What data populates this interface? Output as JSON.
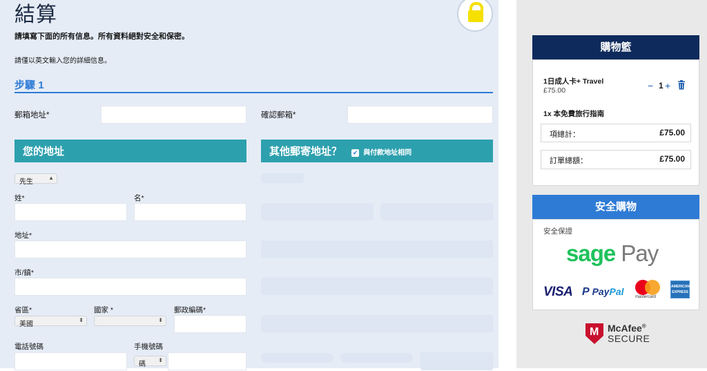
{
  "page": {
    "title": "結算",
    "intro": "請填寫下面的所有信息。所有資料絕對安全和保密。",
    "english_note": "請僅以英文輸入您的詳細信息。",
    "step_label": "步驟",
    "step_number": "1"
  },
  "email": {
    "email_label": "郵箱地址*",
    "confirm_label": "確認郵箱*"
  },
  "address": {
    "header": "您的地址",
    "title_select": "先生",
    "surname_label": "姓*",
    "given_name_label": "名*",
    "address_label": "地址*",
    "city_label": "市/鎮*",
    "province_label": "省區*",
    "province_value": "美國",
    "country_label": "國家 *",
    "country_value": "",
    "postcode_label": "郵政編碼*",
    "phone_label": "電話號碼",
    "mobile_label": "手機號碼",
    "mobile_code_value": "碼"
  },
  "alt_address": {
    "header": "其他郵寄地址？",
    "same_as_billing_label": "與付款地址相同",
    "same_as_billing_checked": true
  },
  "cart": {
    "header": "購物籃",
    "item_name": "1日成人卡+ Travel",
    "item_price": "£75.00",
    "minus": "−",
    "quantity": "1",
    "plus": "+",
    "free_item": "1x 本免費旅行指南",
    "subtotal_label": "項總計：",
    "subtotal_value": "£75.00",
    "total_label": "訂單總額：",
    "total_value": "£75.00"
  },
  "secure": {
    "header": "安全購物",
    "guarantee_label": "安全保證",
    "sage_part1": "sage",
    "sage_part2": "Pay",
    "visa": "VISA",
    "paypal_p": "P",
    "paypal_a": "Pay",
    "paypal_b": "Pal",
    "mastercard_text": "mastercard",
    "amex_text": "AMERICAN EXPRESS",
    "mcafee_name": "McAfee",
    "mcafee_reg": "®",
    "mcafee_secure": "SECURE"
  },
  "colors": {
    "left_bg": "#e5ecf6",
    "accent_blue": "#2e7bd6",
    "teal_bar": "#2da0ae",
    "cart_header": "#0e2a5c",
    "secure_header": "#2e7bd6",
    "lock_yellow": "#f5e000"
  },
  "icons": {
    "lock": "lock-icon",
    "trash": "trash-icon",
    "check": "check-icon",
    "select_arrow": "updown-arrow-icon"
  }
}
